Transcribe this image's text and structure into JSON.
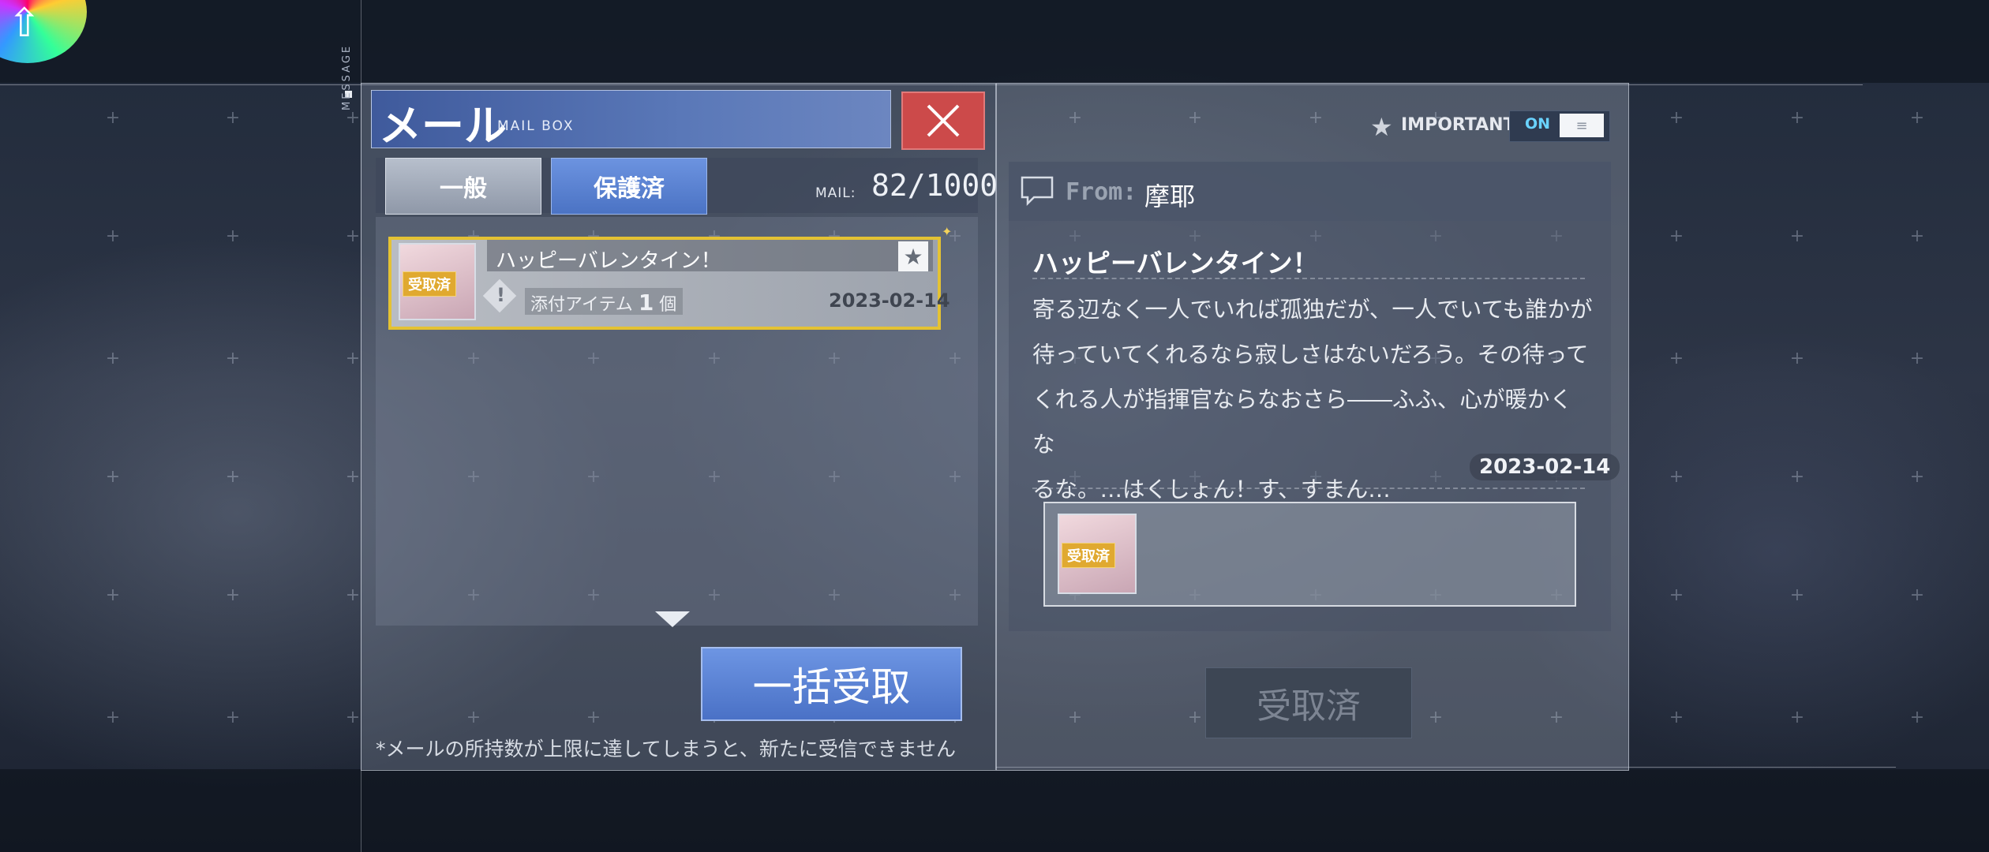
{
  "header": {
    "title_jp": "メール",
    "title_en": "MAIL BOX",
    "side_label": "MESSAGE"
  },
  "tabs": {
    "general": "一般",
    "protected": "保護済",
    "active": "protected"
  },
  "mail_count": {
    "label": "MAIL:",
    "value": "82/1000"
  },
  "mail_list": [
    {
      "title": "ハッピーバレンタイン！",
      "stamp": "受取済",
      "attachment_label": "添付アイテム",
      "attachment_count": "1",
      "attachment_unit": "個",
      "date": "2023-02-14",
      "starred": true,
      "attention_mark": "!"
    }
  ],
  "bulk_receive_button": "一括受取",
  "footnote": "*メールの所持数が上限に達してしまうと、新たに受信できません",
  "detail": {
    "important_label": "IMPORTANT",
    "toggle_label": "ON",
    "toggle_knob": "≡",
    "from_label": "From:",
    "from_name": "摩耶",
    "subject": "ハッピーバレンタイン！",
    "body_lines": [
      "寄る辺なく一人でいれば孤独だが、一人でいても誰かが",
      "待っていてくれるなら寂しさはないだろう。その待って",
      "くれる人が指揮官ならなおさら――ふふ、心が暖かくな",
      "るな。…はくしょん！す、すまん…"
    ],
    "date": "2023-02-14",
    "reward_stamp": "受取済",
    "received_button": "受取済"
  },
  "colors": {
    "accent_blue": "#4a71c6",
    "close_red": "#cc4a4a",
    "highlight_yellow": "#e4c233",
    "stamp_gold": "#e0a930"
  },
  "icons": [
    "close-icon",
    "star-icon",
    "chat-icon",
    "attention-icon",
    "scroll-down-icon",
    "menu-lines-icon"
  ]
}
